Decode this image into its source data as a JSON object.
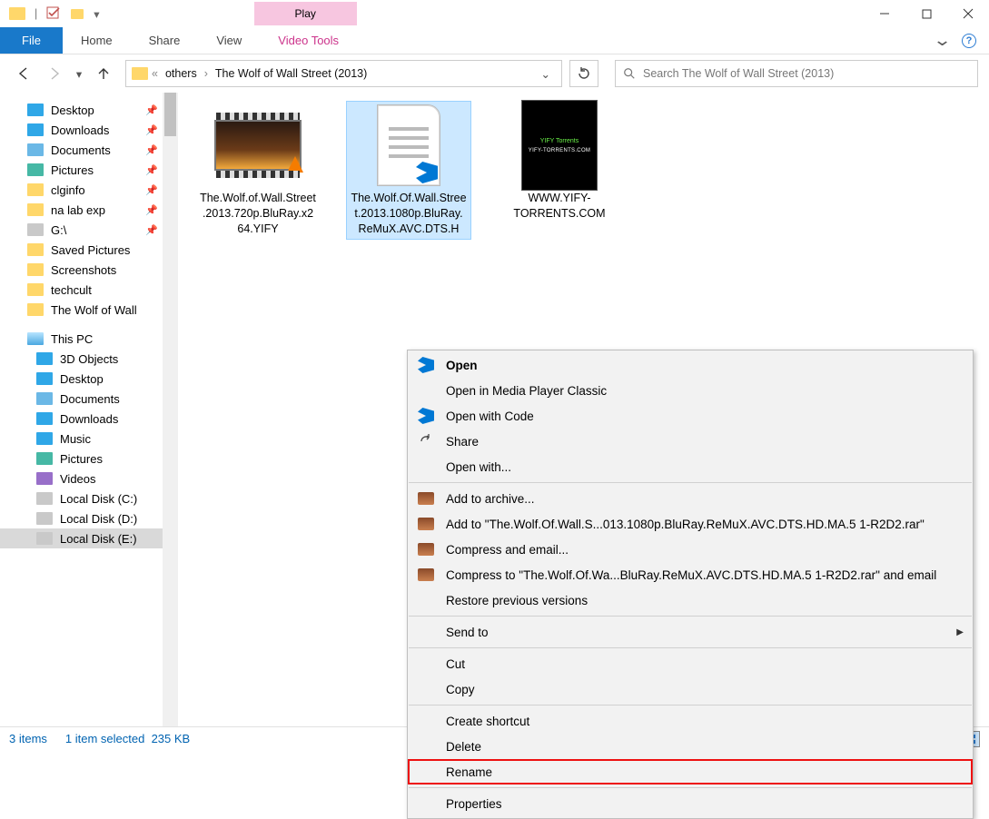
{
  "title_tab": {
    "play": "Play",
    "video_tools": "Video Tools"
  },
  "ribbon": {
    "file": "File",
    "home": "Home",
    "share": "Share",
    "view": "View"
  },
  "breadcrumb": {
    "root": "«",
    "l1": "others",
    "l2": "The Wolf of Wall Street (2013)"
  },
  "search": {
    "placeholder": "Search The Wolf of Wall Street (2013)"
  },
  "sidebar_quick": [
    {
      "label": "Desktop",
      "icon": "desk",
      "pinned": true
    },
    {
      "label": "Downloads",
      "icon": "dl",
      "pinned": true
    },
    {
      "label": "Documents",
      "icon": "doc",
      "pinned": true
    },
    {
      "label": "Pictures",
      "icon": "pic",
      "pinned": true
    },
    {
      "label": "clginfo",
      "icon": "folder",
      "pinned": true
    },
    {
      "label": "na lab exp",
      "icon": "folder",
      "pinned": true
    },
    {
      "label": "G:\\",
      "icon": "drive",
      "pinned": true
    },
    {
      "label": "Saved Pictures",
      "icon": "folder",
      "pinned": false
    },
    {
      "label": "Screenshots",
      "icon": "folder",
      "pinned": false
    },
    {
      "label": "techcult",
      "icon": "folder",
      "pinned": false
    },
    {
      "label": "The Wolf of Wall",
      "icon": "folder",
      "pinned": false
    }
  ],
  "sidebar_pc_label": "This PC",
  "sidebar_pc": [
    {
      "label": "3D Objects",
      "icon": "pc"
    },
    {
      "label": "Desktop",
      "icon": "desk"
    },
    {
      "label": "Documents",
      "icon": "doc"
    },
    {
      "label": "Downloads",
      "icon": "dl"
    },
    {
      "label": "Music",
      "icon": "music"
    },
    {
      "label": "Pictures",
      "icon": "pic"
    },
    {
      "label": "Videos",
      "icon": "vid"
    },
    {
      "label": "Local Disk (C:)",
      "icon": "drive"
    },
    {
      "label": "Local Disk (D:)",
      "icon": "drive"
    },
    {
      "label": "Local Disk (E:)",
      "icon": "drive",
      "selected": true
    }
  ],
  "files": [
    {
      "name": "The.Wolf.of.Wall.Street.2013.720p.BluRay.x264.YIFY",
      "type": "video"
    },
    {
      "name": "The.Wolf.Of.Wall.Street.2013.1080p.BluRay.ReMuX.AVC.DTS.H",
      "type": "document",
      "selected": true
    },
    {
      "name": "WWW.YIFY-TORRENTS.COM",
      "type": "image"
    }
  ],
  "yify": {
    "brand": "YIFY Torrents",
    "site": "YIFY-TORRENTS.COM"
  },
  "context_menu": {
    "open": "Open",
    "open_mpc": "Open in Media Player Classic",
    "open_code": "Open with Code",
    "share": "Share",
    "open_with": "Open with...",
    "add_archive": "Add to archive...",
    "add_to_rar": "Add to \"The.Wolf.Of.Wall.S...013.1080p.BluRay.ReMuX.AVC.DTS.HD.MA.5 1-R2D2.rar\"",
    "compress_email": "Compress and email...",
    "compress_to": "Compress to \"The.Wolf.Of.Wa...BluRay.ReMuX.AVC.DTS.HD.MA.5 1-R2D2.rar\" and email",
    "restore": "Restore previous versions",
    "send_to": "Send to",
    "cut": "Cut",
    "copy": "Copy",
    "shortcut": "Create shortcut",
    "delete": "Delete",
    "rename": "Rename",
    "properties": "Properties"
  },
  "status": {
    "count": "3 items",
    "selection": "1 item selected",
    "size": "235 KB"
  }
}
